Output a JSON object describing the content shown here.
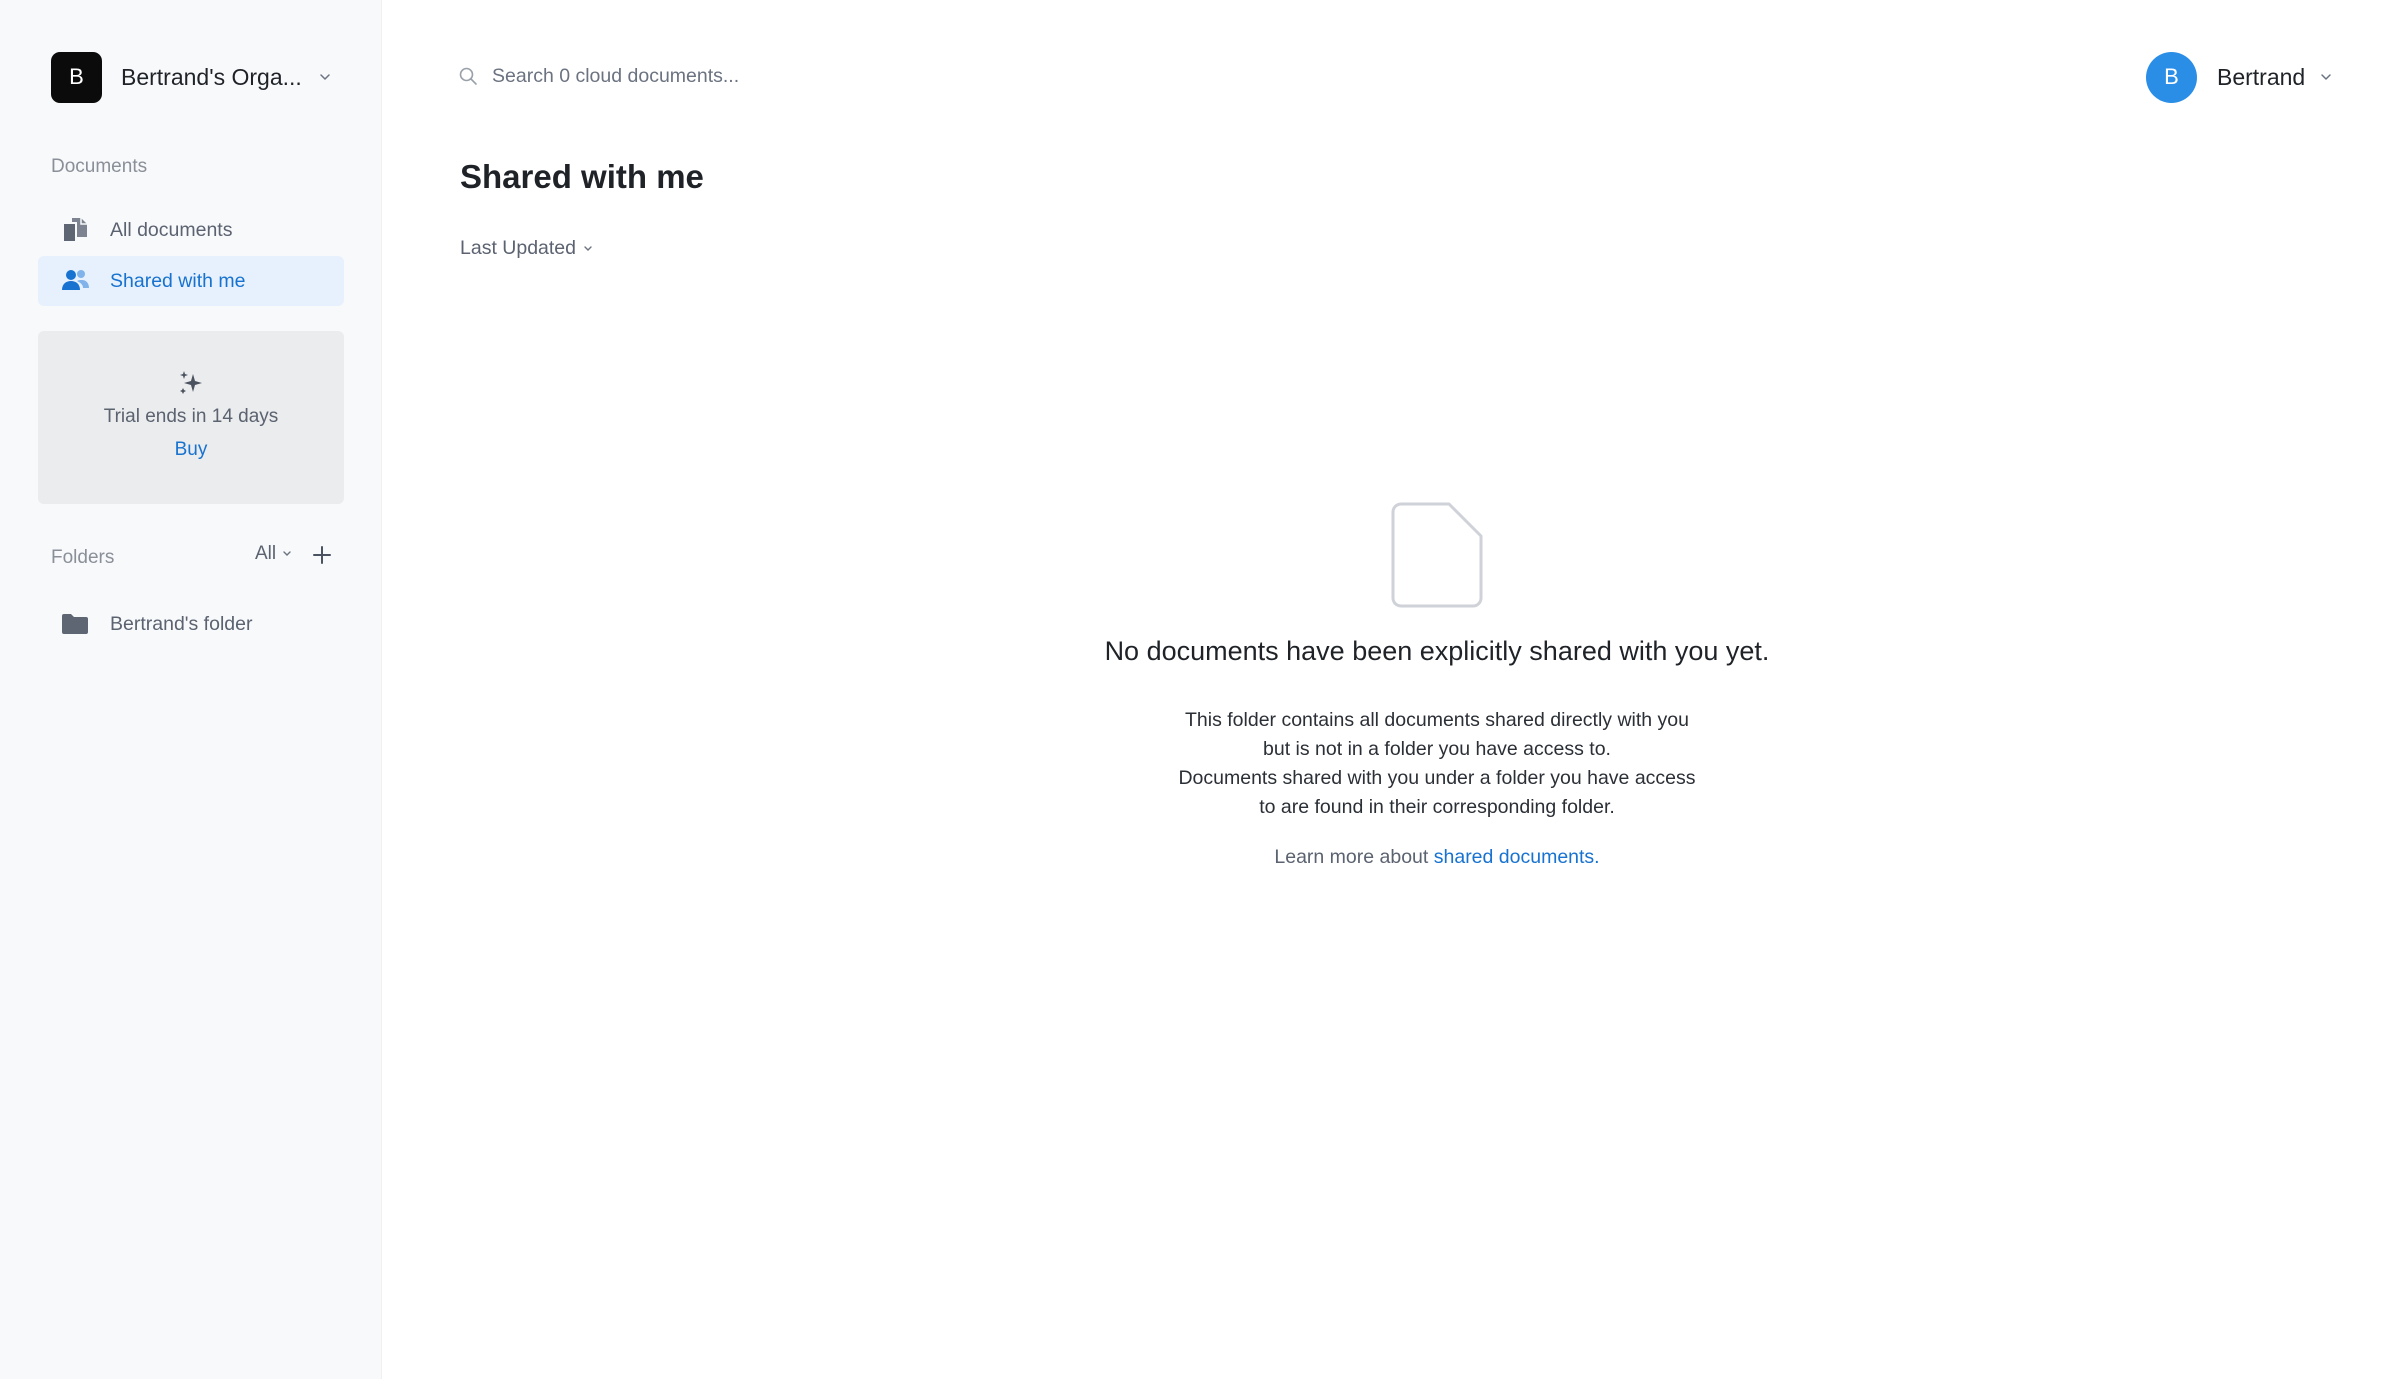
{
  "sidebar": {
    "org": {
      "initial": "B",
      "name": "Bertrand's Orga..."
    },
    "documents_label": "Documents",
    "nav": [
      {
        "label": "All documents",
        "icon": "documents-icon",
        "active": false
      },
      {
        "label": "Shared with me",
        "icon": "shared-users-icon",
        "active": true
      }
    ],
    "trial": {
      "text": "Trial ends in 14 days",
      "buy_label": "Buy",
      "icon": "sparkles-icon"
    },
    "folders": {
      "label": "Folders",
      "filter": "All",
      "items": [
        {
          "label": "Bertrand's folder",
          "icon": "folder-icon"
        }
      ]
    }
  },
  "header": {
    "search_placeholder": "Search 0 cloud documents...",
    "user": {
      "initial": "B",
      "name": "Bertrand"
    }
  },
  "main": {
    "title": "Shared with me",
    "sort_label": "Last Updated",
    "empty": {
      "icon": "file-icon",
      "title": "No documents have been explicitly shared with you yet.",
      "lines": [
        "This folder contains all documents shared directly with you",
        "but is not in a folder you have access to.",
        "Documents shared with you under a folder you have access",
        "to are found in their corresponding folder."
      ],
      "learn_prefix": "Learn more about ",
      "learn_link": "shared documents."
    }
  },
  "colors": {
    "accent": "#1772d0",
    "active_bg": "#e7f1fd",
    "sidebar_bg": "#f8f9fb",
    "user_avatar": "#2b8ee6",
    "org_avatar": "#0b0b0b"
  }
}
